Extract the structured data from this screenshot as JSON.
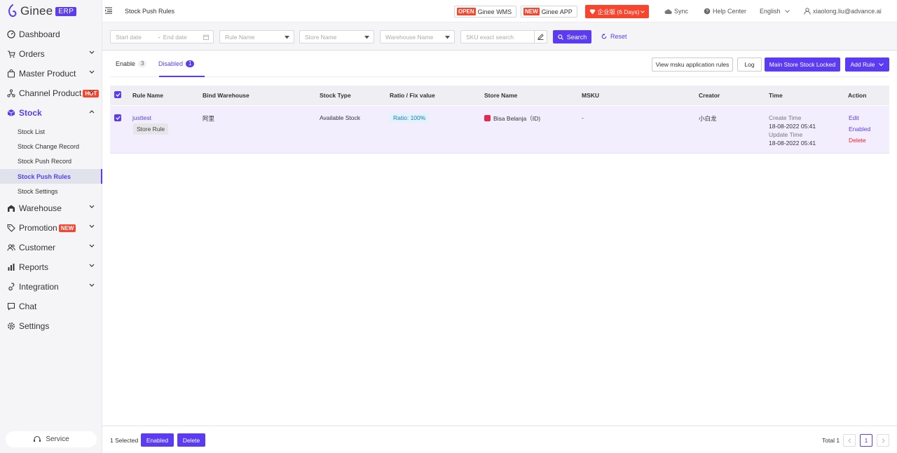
{
  "brand": {
    "name": "Ginee",
    "badge": "ERP"
  },
  "sidebar": {
    "items": [
      {
        "label": "Dashboard",
        "icon": "gauge-icon"
      },
      {
        "label": "Orders",
        "icon": "cart-icon",
        "has_children": true
      },
      {
        "label": "Master Product",
        "icon": "bag-icon",
        "has_children": true
      },
      {
        "label": "Channel Product",
        "icon": "share-icon",
        "badge": "HOT",
        "has_children": true
      },
      {
        "label": "Stock",
        "icon": "cube-icon",
        "expanded": true,
        "active": true
      },
      {
        "label": "Warehouse",
        "icon": "warehouse-icon",
        "has_children": true
      },
      {
        "label": "Promotion",
        "icon": "tag-icon",
        "badge": "NEW",
        "has_children": true
      },
      {
        "label": "Customer",
        "icon": "users-icon",
        "has_children": true
      },
      {
        "label": "Reports",
        "icon": "bar-chart-icon",
        "has_children": true
      },
      {
        "label": "Integration",
        "icon": "link-icon",
        "has_children": true
      },
      {
        "label": "Chat",
        "icon": "chat-icon"
      },
      {
        "label": "Settings",
        "icon": "gear-icon"
      }
    ],
    "stock_children": [
      {
        "label": "Stock List"
      },
      {
        "label": "Stock Change Record"
      },
      {
        "label": "Stock Push Record"
      },
      {
        "label": "Stock Push Rules",
        "active": true
      },
      {
        "label": "Stock Settings"
      }
    ],
    "service_label": "Service"
  },
  "header": {
    "title": "Stock Push Rules",
    "wms": {
      "badge": "OPEN",
      "label": "Ginee WMS"
    },
    "app": {
      "badge": "NEW",
      "label": "Ginee APP"
    },
    "plan": "企业版 (6 Days)",
    "sync": "Sync",
    "help": "Help Center",
    "language": "English",
    "user": "xiaolong.liu@advance.ai"
  },
  "filters": {
    "start_date": "Start date",
    "end_date": "End date",
    "rule_name": "Rule Name",
    "store_name": "Store Name",
    "warehouse_name": "Warehouse Name",
    "sku_search": "SKU exact search",
    "search": "Search",
    "reset": "Reset"
  },
  "tabs": [
    {
      "label": "Enable",
      "count": "3"
    },
    {
      "label": "Disabled",
      "count": "1",
      "active": true
    }
  ],
  "actions": {
    "view_msku": "View msku application rules",
    "log": "Log",
    "main_store_locked": "Main Store Stock Locked",
    "add_rule": "Add Rule"
  },
  "table": {
    "columns": [
      "Rule Name",
      "Bind Warehouse",
      "Stock Type",
      "Ratio / Fix value",
      "Store Name",
      "MSKU",
      "Creator",
      "Time",
      "Action"
    ],
    "rows": [
      {
        "rule_name": "justtest",
        "rule_tag": "Store Rule",
        "bind_warehouse": "阿里",
        "stock_type": "Available Stock",
        "ratio": "Ratio: 100%",
        "store_name": "Bisa Belanja（ID)",
        "msku": "-",
        "creator": "小白龙",
        "create_label": "Create Time",
        "create_time": "18-08-2022 05:41",
        "update_label": "Update Time",
        "update_time": "18-08-2022 05:41",
        "actions": {
          "edit": "Edit",
          "enabled": "Enabled",
          "delete": "Delete"
        },
        "checked": true
      }
    ]
  },
  "footer": {
    "selected": "1 Selected",
    "enabled": "Enabled",
    "delete": "Delete",
    "total": "Total 1",
    "current_page": "1"
  },
  "colors": {
    "primary": "#5b3cf3",
    "danger": "#f7452e",
    "row_selected": "#f3eefd"
  }
}
